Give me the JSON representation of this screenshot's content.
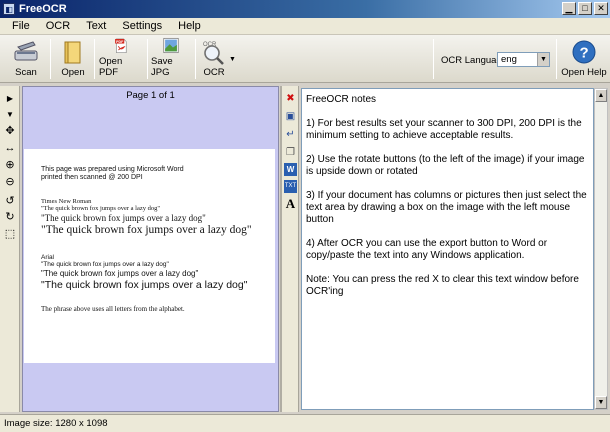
{
  "window": {
    "title": "FreeOCR"
  },
  "menu": [
    "File",
    "OCR",
    "Text",
    "Settings",
    "Help"
  ],
  "toolbar": {
    "scan": "Scan",
    "open": "Open",
    "open_pdf": "Open PDF",
    "save_jpg": "Save JPG",
    "ocr": "OCR",
    "ocr_language_label": "OCR Language:",
    "ocr_language_value": "eng",
    "open_help": "Open Help"
  },
  "image_pane": {
    "page_info": "Page 1 of 1",
    "doc_lines": [
      "This page was prepared using Microsoft Word",
      "printed then scanned @ 200 DPI",
      "Times New Roman",
      "\"The quick brown fox jumps over a lazy dog\"",
      "\"The quick brown fox jumps over a lazy dog\"",
      "\"The quick brown fox jumps over a lazy dog\"",
      "Arial",
      "\"The quick brown fox jumps over a lazy dog\"",
      "\"The quick brown fox  jumps over a lazy dog\"",
      "\"The quick brown fox jumps over a lazy dog\"",
      "The phrase above uses all letters from the alphabet."
    ]
  },
  "notes": {
    "title": "FreeOCR notes",
    "paragraphs": [
      "1) For best results set your scanner to 300 DPI, 200 DPI is the minimum setting to achieve acceptable results.",
      "2) Use the rotate buttons (to the left of the image) if your image is upside down or rotated",
      "3) If your document has columns or pictures then just select the text area by drawing a box on the image with the left mouse button",
      "4) After OCR you can use the export button to Word or copy/paste the text into any Windows application.",
      "Note: You can press the red X to clear this text window before OCR'ing"
    ]
  },
  "status": {
    "image_size": "Image size:  1280 x 1098"
  },
  "colors": {
    "image_pane_bg": "#c9c9f2",
    "title_bar": "#0a246a",
    "clear_x": "#d01010"
  }
}
